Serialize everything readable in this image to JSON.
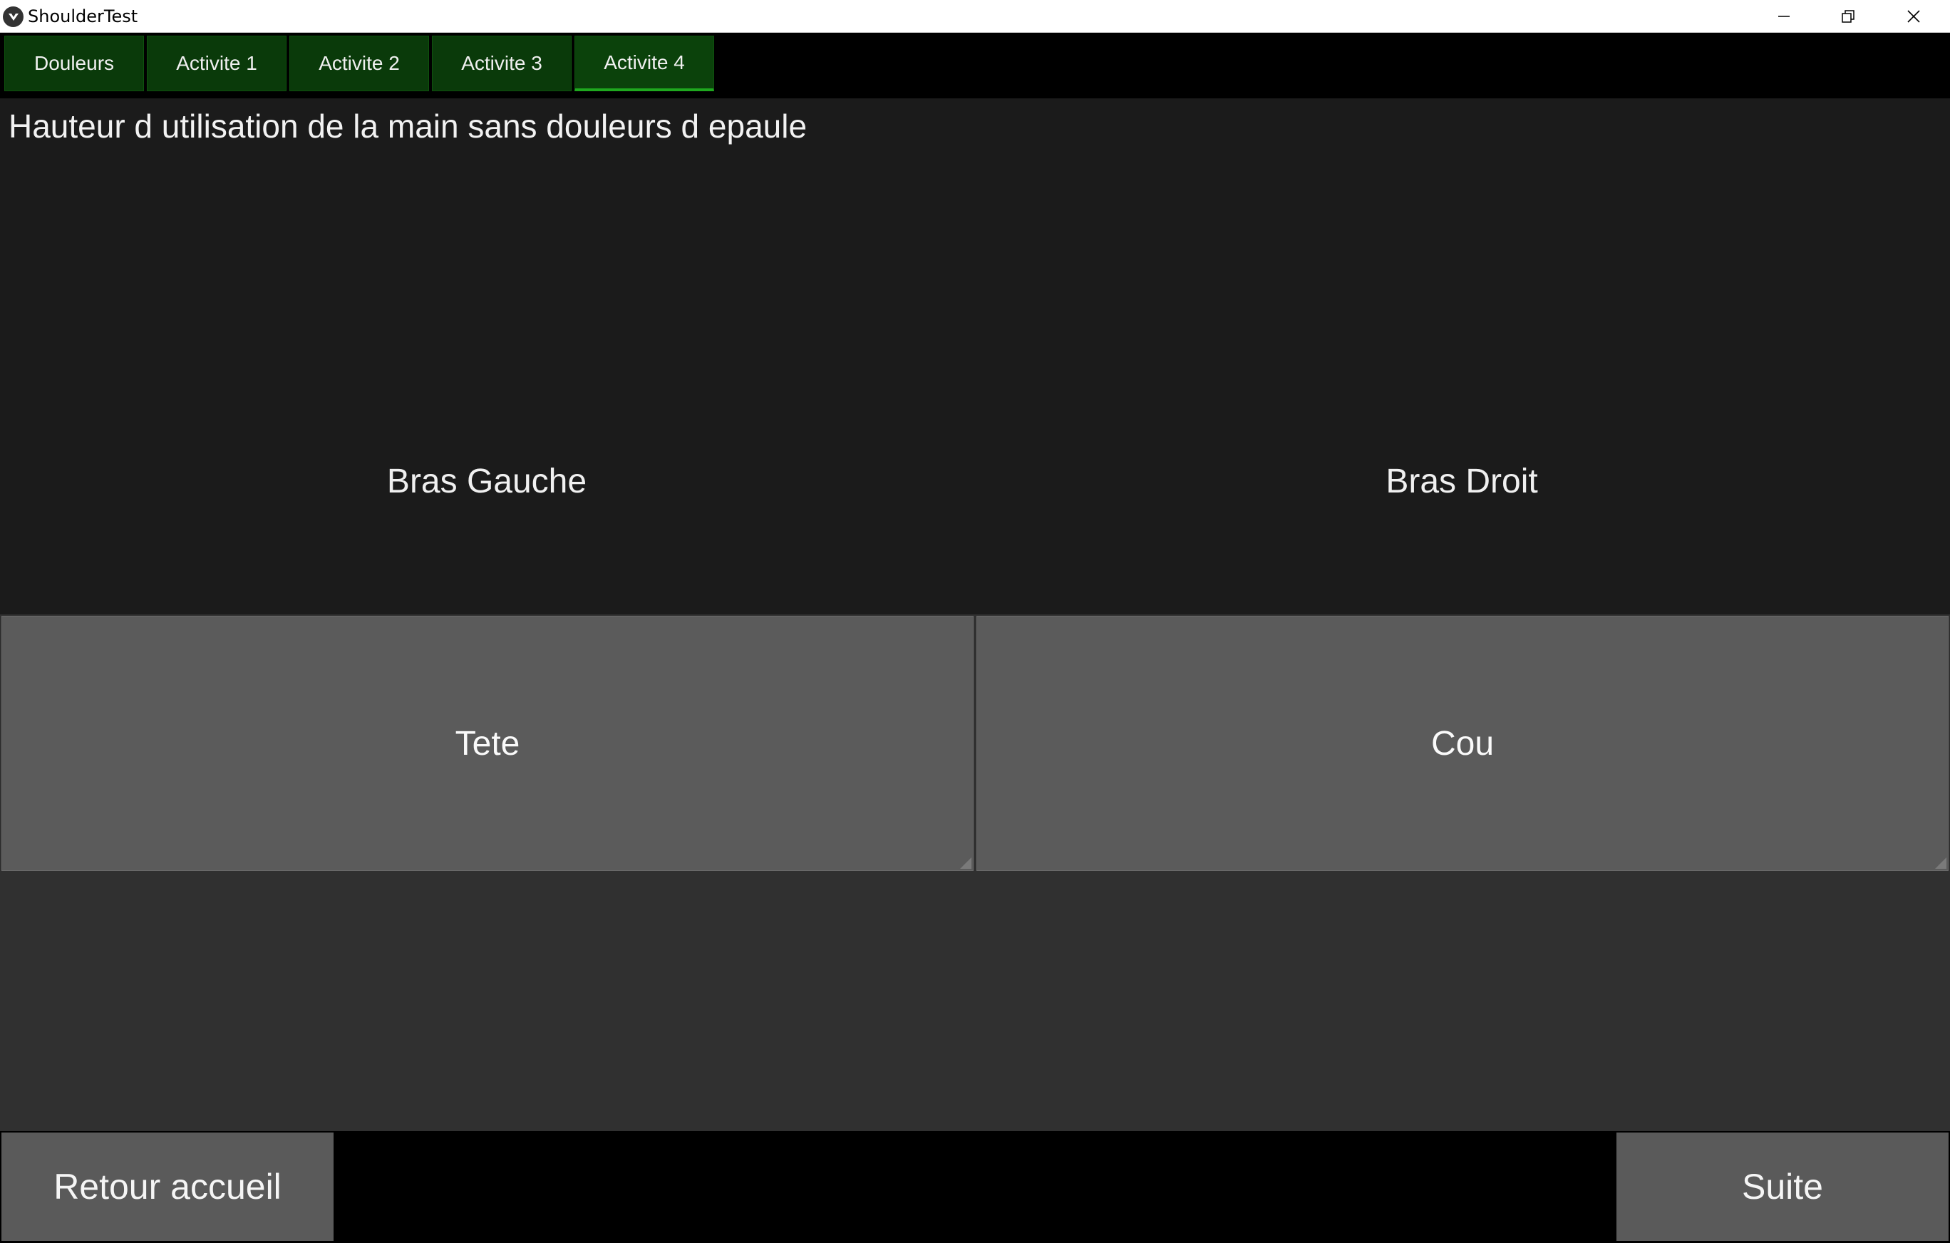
{
  "window": {
    "title": "ShoulderTest",
    "controls": {
      "minimize_icon": "minimize-icon",
      "restore_icon": "restore-icon",
      "close_icon": "close-icon"
    }
  },
  "tabs": [
    {
      "label": "Douleurs",
      "active": false
    },
    {
      "label": "Activite 1",
      "active": false
    },
    {
      "label": "Activite 2",
      "active": false
    },
    {
      "label": "Activite 3",
      "active": false
    },
    {
      "label": "Activite 4",
      "active": true
    }
  ],
  "main": {
    "question": "Hauteur d utilisation de la main sans douleurs d epaule",
    "left_label": "Bras Gauche",
    "right_label": "Bras Droit",
    "left_option": "Tete",
    "right_option": "Cou"
  },
  "footer": {
    "back_label": "Retour accueil",
    "next_label": "Suite"
  },
  "colors": {
    "tab_bg": "#0a3a0a",
    "tab_active_underline": "#1fa81f",
    "button_bg": "#5b5b5b",
    "panel_bg": "#1b1b1b"
  }
}
